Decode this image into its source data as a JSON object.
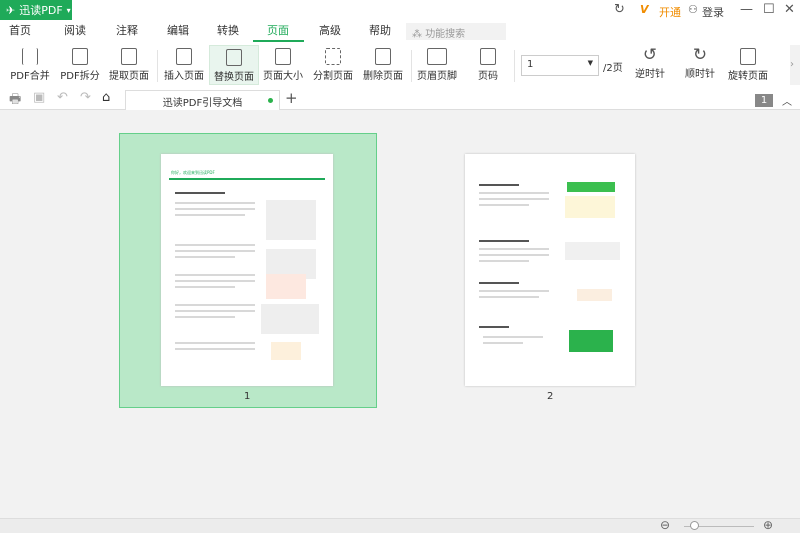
{
  "app": {
    "title": "迅读PDF"
  },
  "titlebar": {
    "vip_label": "开通",
    "login_label": "登录"
  },
  "menu": [
    "首页",
    "阅读",
    "注释",
    "编辑",
    "转换",
    "页面",
    "高级",
    "帮助"
  ],
  "search": {
    "placeholder": "功能搜索"
  },
  "toolbar": [
    "PDF合并",
    "PDF拆分",
    "提取页面",
    "插入页面",
    "替换页面",
    "页面大小",
    "分割页面",
    "删除页面",
    "页眉页脚",
    "页码"
  ],
  "page_select": {
    "value": "1",
    "total": "/2页"
  },
  "rotate": [
    "逆时针",
    "顺时针",
    "旋转页面"
  ],
  "tab": {
    "title": "迅读PDF引导文档"
  },
  "page_badge": "1",
  "pages": [
    {
      "label": "1",
      "heading": "你好，欢迎来到迅读PDF"
    },
    {
      "label": "2"
    }
  ]
}
